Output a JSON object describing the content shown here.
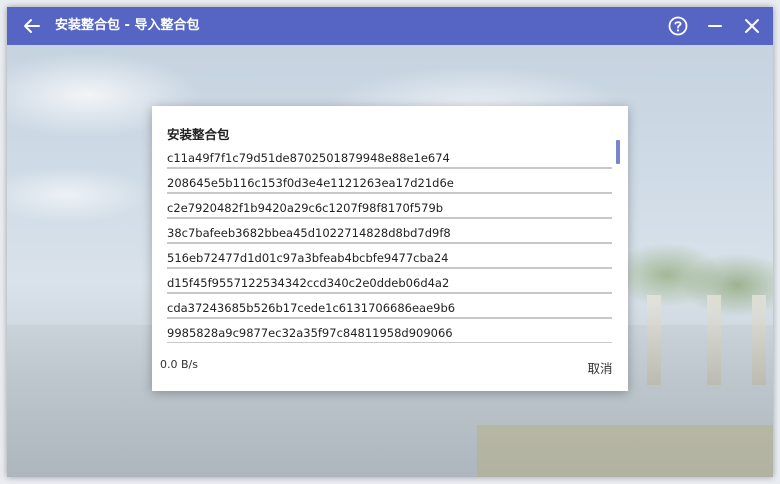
{
  "titlebar": {
    "title": "安装整合包 - 导入整合包",
    "back_icon": "arrow-left-icon",
    "help_icon": "help-circle-icon",
    "minimize_icon": "minimize-icon",
    "close_icon": "close-icon",
    "color": "#5665c4"
  },
  "dialog": {
    "title": "安装整合包",
    "tasks": [
      "c11a49f7f1c79d51de8702501879948e88e1e674",
      "208645e5b116c153f0d3e4e1121263ea17d21d6e",
      "c2e7920482f1b9420a29c6c1207f98f8170f579b",
      "38c7bafeeb3682bbea45d1022714828d8bd7d9f8",
      "516eb72477d1d01c97a3bfeab4bcbfe9477cba24",
      "d15f45f9557122534342ccd340c2e0ddeb06d4a2",
      "cda37243685b526b17cede1c6131706686eae9b6",
      "9985828a9c9877ec32a35f97c84811958d909066"
    ],
    "speed": "0.0 B/s",
    "cancel_label": "取消",
    "scrollbar_color": "#7b86c8"
  }
}
